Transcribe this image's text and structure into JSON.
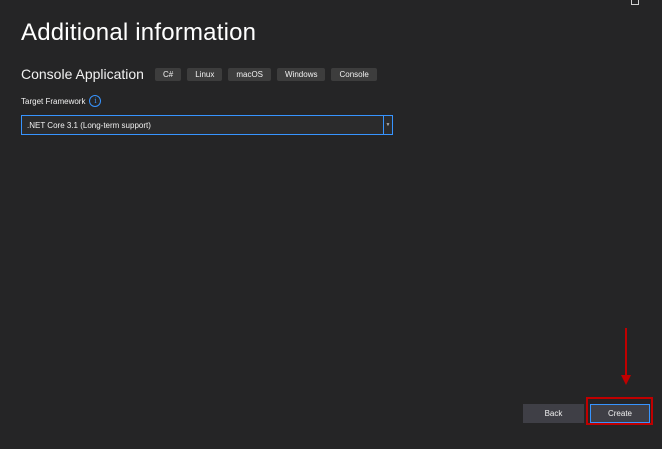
{
  "header": {
    "title": "Additional information"
  },
  "template": {
    "name": "Console Application",
    "tags": [
      "C#",
      "Linux",
      "macOS",
      "Windows",
      "Console"
    ]
  },
  "framework": {
    "label": "Target Framework",
    "info_icon": "info-icon",
    "selected": ".NET Core 3.1 (Long-term support)"
  },
  "footer": {
    "back_label": "Back",
    "create_label": "Create"
  },
  "colors": {
    "background": "#252526",
    "accent": "#3794ff",
    "annotation": "#c00000",
    "button": "#3f3f46"
  }
}
